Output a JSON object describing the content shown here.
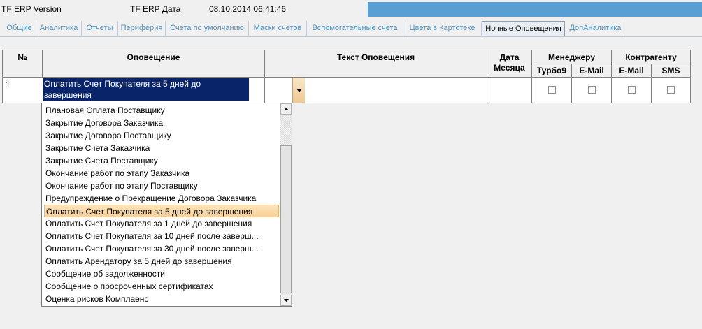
{
  "header": {
    "version_label": "TF ERP Version",
    "date_label": "TF ERP Дата",
    "datetime": "08.10.2014 06:41:46"
  },
  "tabs": [
    {
      "label": "Общие"
    },
    {
      "label": "Аналитика"
    },
    {
      "label": "Отчеты"
    },
    {
      "label": "Периферия"
    },
    {
      "label": "Счета по умолчанию"
    },
    {
      "label": "Маски счетов"
    },
    {
      "label": "Вспомогательные счета"
    },
    {
      "label": "Цвета в Картотеке"
    },
    {
      "label": "Ночные Оповещения",
      "active": true
    },
    {
      "label": "ДопАналитика"
    }
  ],
  "table": {
    "columns": {
      "num": "№",
      "notification": "Оповещение",
      "text": "Текст Оповещения",
      "date_month": "Дата Месяца",
      "manager": "Менеджеру",
      "counterparty": "Контрагенту",
      "turbo9": "Турбо9",
      "email_manager": "E-Mail",
      "email_counterparty": "E-Mail",
      "sms": "SMS"
    },
    "rows": [
      {
        "num": "1",
        "notification": "Оплатить Счет Покупателя за 5 дней до завершения",
        "text": "",
        "date_month": "",
        "turbo9": false,
        "email_manager": false,
        "email_counterparty": false,
        "sms": false
      }
    ]
  },
  "dropdown": {
    "selected": "Оплатить Счет Покупателя за 5 дней до завершения",
    "options": [
      "Плановая Оплата Поставщику",
      "Закрытие Договора Заказчика",
      "Закрытие Договора Поставщику",
      "Закрытие Счета Заказчика",
      "Закрытие Счета Поставщику",
      "Окончание работ по этапу Заказчика",
      "Окончание работ по этапу Поставщику",
      "Предупреждение о Прекращение Договора Заказчика",
      "Оплатить Счет Покупателя за 5 дней до завершения",
      "Оплатить Счет Покупателя за 1 дней до завершения",
      "Оплатить Счет Покупателя за 10 дней после заверш...",
      "Оплатить Счет Покупателя за 30 дней после заверш...",
      "Оплатить Арендатору за 5 дней до завершения",
      "Сообщение об задолженности",
      "Сообщение о просроченных сертификатах",
      "Оценка рисков Комплаенс"
    ]
  },
  "colors": {
    "header_accent": "#5a9fd4",
    "tab_text": "#4a8fc4",
    "selection": "#0a246a",
    "highlight": "#f8d098"
  }
}
